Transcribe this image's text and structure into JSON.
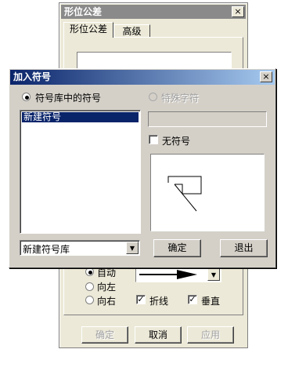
{
  "bg_dialog": {
    "title": "形位公差",
    "close": "×",
    "tabs": [
      "形位公差",
      "高级"
    ],
    "direction_options": [
      "自动",
      "向左",
      "向右"
    ],
    "checkbox_polyline": "折线",
    "checkbox_vertical": "垂直",
    "buttons": {
      "ok": "确定",
      "cancel": "取消",
      "apply": "应用"
    }
  },
  "fg_dialog": {
    "title": "加入符号",
    "close": "×",
    "radio_library": "符号库中的符号",
    "radio_special": "特殊字符",
    "list_items": [
      "新建符号"
    ],
    "checkbox_no_symbol": "无符号",
    "library_select": "新建符号库",
    "buttons": {
      "ok": "确定",
      "exit": "退出"
    }
  },
  "colors": {
    "title_active_start": "#0a246a",
    "title_active_end": "#a6caf0",
    "title_inactive": "#8a8a8a",
    "selection": "#0a246a"
  }
}
